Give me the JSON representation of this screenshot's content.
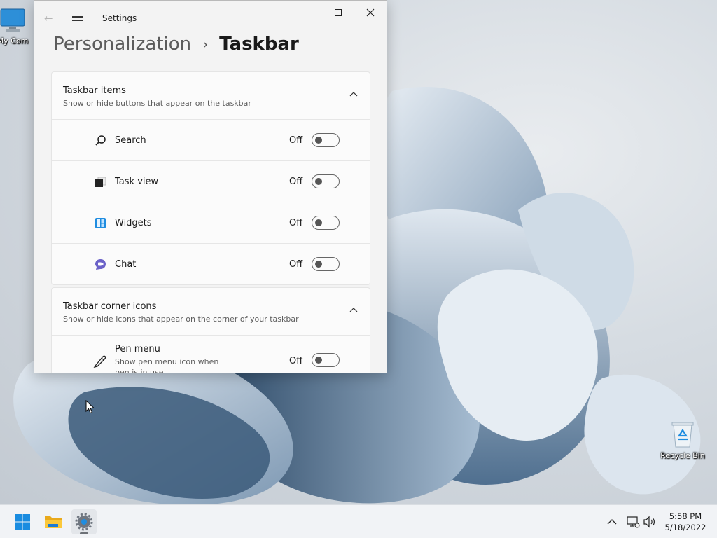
{
  "desktop": {
    "icons": [
      {
        "label": "My Com"
      },
      {
        "label": "Recycle Bin"
      }
    ]
  },
  "window": {
    "title": "Settings",
    "breadcrumb": {
      "parent": "Personalization",
      "separator": "›",
      "current": "Taskbar"
    }
  },
  "taskbar_items": {
    "title": "Taskbar items",
    "subtitle": "Show or hide buttons that appear on the taskbar",
    "items": [
      {
        "label": "Search",
        "state": "Off",
        "icon": "search-icon"
      },
      {
        "label": "Task view",
        "state": "Off",
        "icon": "task-view-icon"
      },
      {
        "label": "Widgets",
        "state": "Off",
        "icon": "widgets-icon"
      },
      {
        "label": "Chat",
        "state": "Off",
        "icon": "chat-icon"
      }
    ]
  },
  "taskbar_corner_icons": {
    "title": "Taskbar corner icons",
    "subtitle": "Show or hide icons that appear on the corner of your taskbar",
    "items": [
      {
        "label": "Pen menu",
        "description": "Show pen menu icon when pen is in use",
        "state": "Off",
        "icon": "pen-icon"
      }
    ]
  },
  "taskbar": {
    "apps": [
      "start-icon",
      "file-explorer-icon",
      "settings-icon"
    ],
    "clock": {
      "time": "5:58 PM",
      "date": "5/18/2022"
    }
  },
  "colors": {
    "accent": "#0067c0",
    "window_bg": "#f3f3f3",
    "card_bg": "#fbfbfb"
  }
}
